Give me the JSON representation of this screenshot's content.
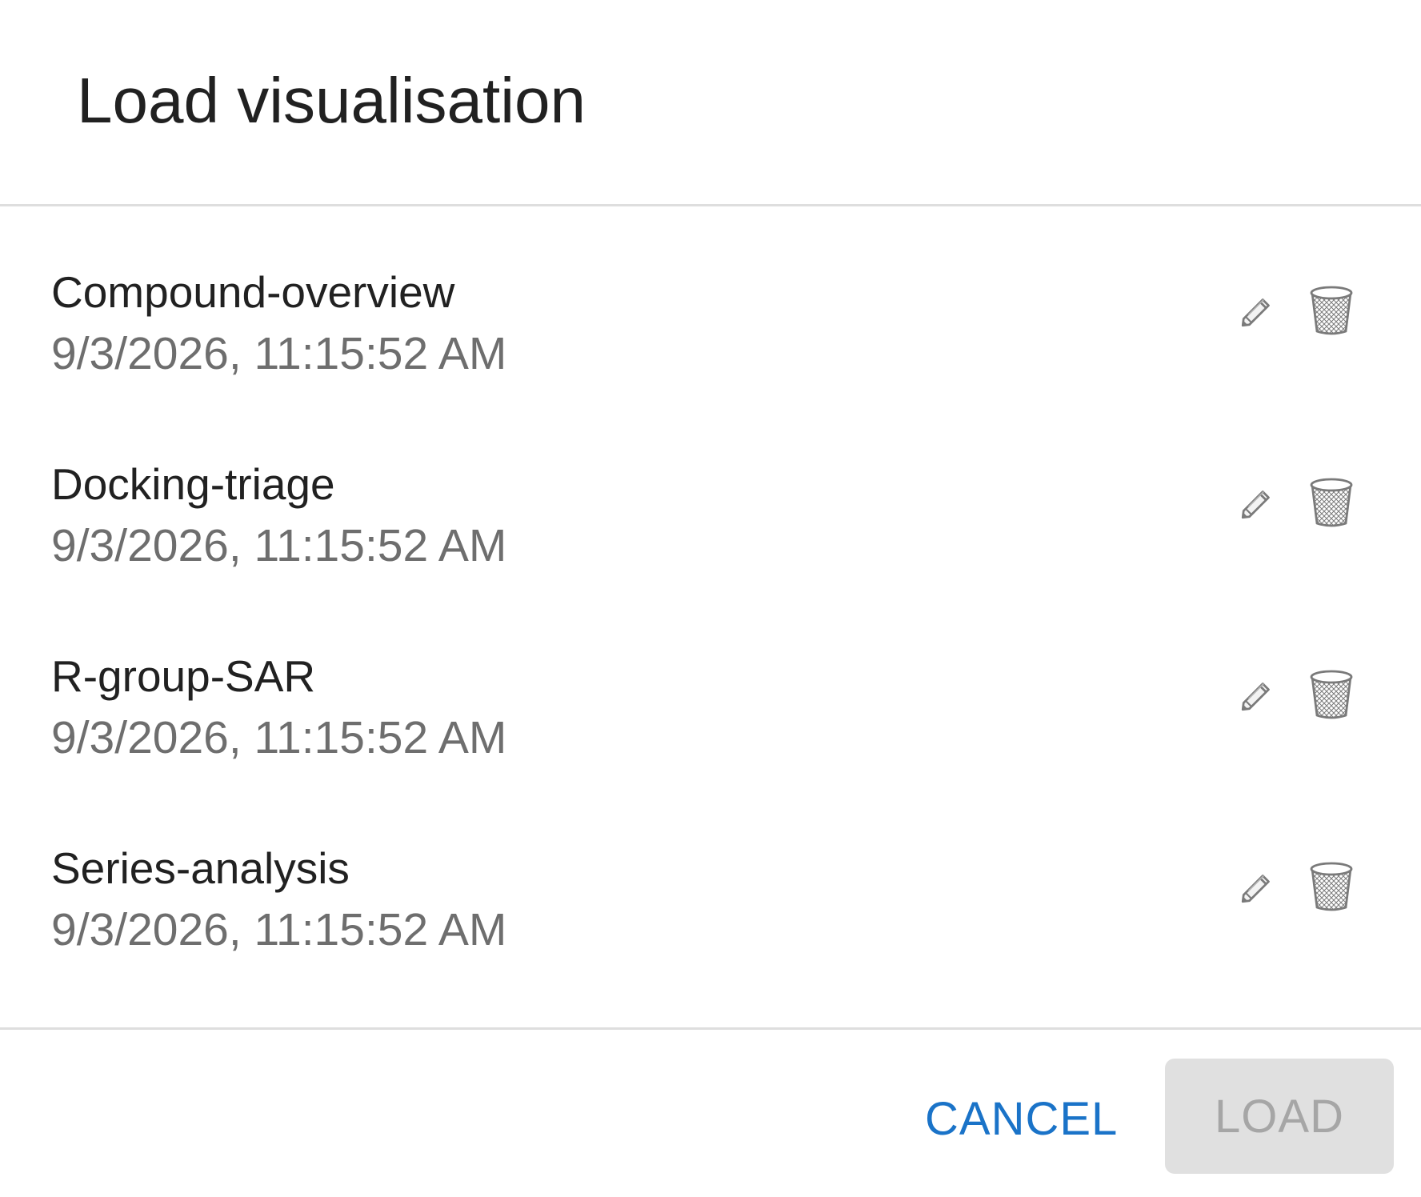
{
  "dialog": {
    "title": "Load visualisation"
  },
  "items": [
    {
      "name": "Compound-overview",
      "date": "9/3/2026, 11:15:52 AM"
    },
    {
      "name": "Docking-triage",
      "date": "9/3/2026, 11:15:52 AM"
    },
    {
      "name": "R-group-SAR",
      "date": "9/3/2026, 11:15:52 AM"
    },
    {
      "name": "Series-analysis",
      "date": "9/3/2026, 11:15:52 AM"
    }
  ],
  "footer": {
    "cancel_label": "CANCEL",
    "load_label": "LOAD"
  },
  "colors": {
    "accent": "#1a73c8",
    "disabled_bg": "#e0e0e0",
    "disabled_text": "#a6a6a6",
    "icon": "#7a7a7a"
  },
  "icons": {
    "rename": "pencil-icon",
    "delete": "trash-icon"
  }
}
